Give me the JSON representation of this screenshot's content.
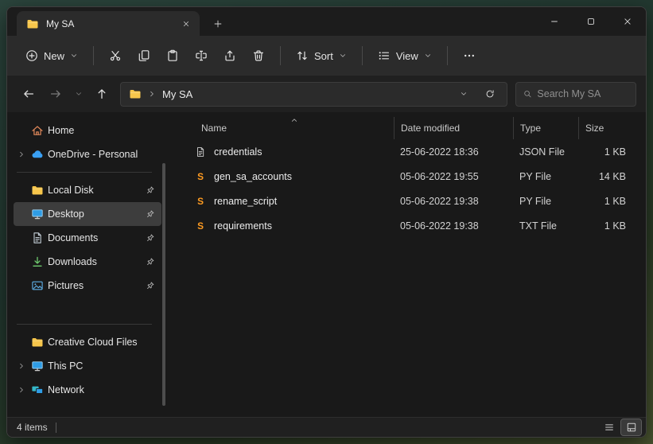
{
  "colors": {
    "folder_yellow": "#f7c64b",
    "sublime_orange": "#ff9b21",
    "onedrive_blue": "#3aa0f3",
    "selection_bg": "#3d3d3d",
    "window_bg": "#202020",
    "pane_bg": "#191919"
  },
  "tab": {
    "title": "My SA"
  },
  "toolbar": {
    "new": "New",
    "sort": "Sort",
    "view": "View"
  },
  "address": {
    "path": "My SA",
    "search_placeholder": "Search My SA"
  },
  "sidebar": {
    "items": [
      {
        "label": "Home"
      },
      {
        "label": "OneDrive - Personal"
      },
      {
        "label": "Local Disk"
      },
      {
        "label": "Desktop"
      },
      {
        "label": "Documents"
      },
      {
        "label": "Downloads"
      },
      {
        "label": "Pictures"
      },
      {
        "label": "Creative Cloud Files"
      },
      {
        "label": "This PC"
      },
      {
        "label": "Network"
      }
    ]
  },
  "list": {
    "columns": {
      "name": "Name",
      "date": "Date modified",
      "type": "Type",
      "size": "Size"
    },
    "rows": [
      {
        "name": "credentials",
        "date": "25-06-2022 18:36",
        "type": "JSON File",
        "size": "1 KB"
      },
      {
        "name": "gen_sa_accounts",
        "date": "05-06-2022 19:55",
        "type": "PY File",
        "size": "14 KB"
      },
      {
        "name": "rename_script",
        "date": "05-06-2022 19:38",
        "type": "PY File",
        "size": "1 KB"
      },
      {
        "name": "requirements",
        "date": "05-06-2022 19:38",
        "type": "TXT File",
        "size": "1 KB"
      }
    ]
  },
  "status": {
    "count": "4 items"
  }
}
